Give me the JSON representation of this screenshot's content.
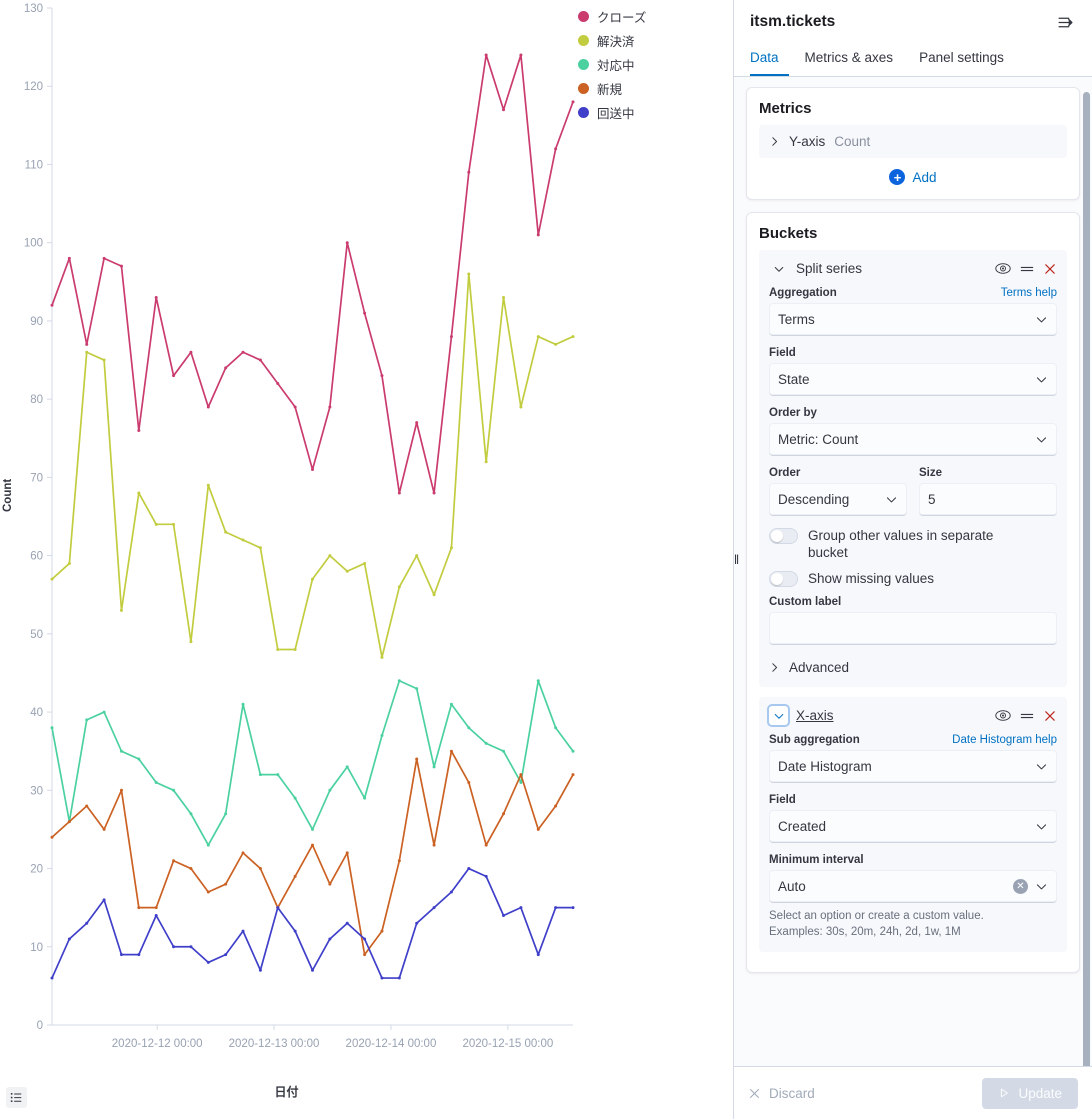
{
  "panel": {
    "title": "itsm.tickets",
    "collapse_icon": "collapse-right-icon",
    "tabs": [
      {
        "label": "Data",
        "active": true
      },
      {
        "label": "Metrics & axes",
        "active": false
      },
      {
        "label": "Panel settings",
        "active": false
      }
    ],
    "metrics": {
      "title": "Metrics",
      "rows": [
        {
          "label": "Y-axis",
          "value": "Count"
        }
      ],
      "add_label": "Add"
    },
    "buckets": {
      "title": "Buckets",
      "split_series": {
        "name": "Split series",
        "aggregation_label": "Aggregation",
        "aggregation_help": "Terms help",
        "aggregation_value": "Terms",
        "field_label": "Field",
        "field_value": "State",
        "order_by_label": "Order by",
        "order_by_value": "Metric: Count",
        "order_label": "Order",
        "order_value": "Descending",
        "size_label": "Size",
        "size_value": "5",
        "group_other_label": "Group other values in separate bucket",
        "group_other_on": false,
        "show_missing_label": "Show missing values",
        "show_missing_on": false,
        "custom_label_label": "Custom label",
        "custom_label_value": "",
        "advanced_label": "Advanced"
      },
      "x_axis": {
        "name": "X-axis",
        "sub_agg_label": "Sub aggregation",
        "sub_agg_help": "Date Histogram help",
        "sub_agg_value": "Date Histogram",
        "field_label": "Field",
        "field_value": "Created",
        "min_interval_label": "Minimum interval",
        "min_interval_value": "Auto",
        "hint_line1": "Select an option or create a custom value.",
        "hint_line2": "Examples: 30s, 20m, 24h, 2d, 1w, 1M"
      }
    },
    "footer": {
      "discard_label": "Discard",
      "update_label": "Update"
    }
  },
  "toolbar": {
    "inspect_icon": "list-inspect-icon"
  },
  "chart_data": {
    "type": "line",
    "title": "",
    "xlabel": "日付",
    "ylabel": "Count",
    "ylim": [
      0,
      130
    ],
    "yticks": [
      0,
      10,
      20,
      30,
      40,
      50,
      60,
      70,
      80,
      90,
      100,
      110,
      120,
      130
    ],
    "grid": false,
    "legend_position": "top-right",
    "xtick_labels": [
      "2020-12-12 00:00",
      "2020-12-13 00:00",
      "2020-12-14 00:00",
      "2020-12-15 00:00"
    ],
    "xtick_positions": [
      0.2019,
      0.4262,
      0.6506,
      0.875
    ],
    "colors": {
      "クローズ": "#ca3b6e",
      "解決済": "#c2cc3f",
      "対応中": "#4bd1a0",
      "新規": "#cb6122",
      "回送中": "#3f3fc9"
    },
    "series": [
      {
        "name": "クローズ",
        "color": "#ca3b6e",
        "values": [
          92,
          98,
          87,
          98,
          97,
          76,
          93,
          83,
          86,
          79,
          84,
          86,
          85,
          82,
          79,
          71,
          79,
          100,
          91,
          83,
          68,
          77,
          68,
          88,
          109,
          124,
          117,
          124,
          101,
          112,
          118
        ]
      },
      {
        "name": "解決済",
        "color": "#c2cc3f",
        "values": [
          57,
          59,
          86,
          85,
          53,
          68,
          64,
          64,
          49,
          69,
          63,
          62,
          61,
          48,
          48,
          57,
          60,
          58,
          59,
          47,
          56,
          60,
          55,
          61,
          96,
          72,
          93,
          79,
          88,
          87,
          88
        ]
      },
      {
        "name": "対応中",
        "color": "#4bd1a0",
        "values": [
          38,
          26,
          39,
          40,
          35,
          34,
          31,
          30,
          27,
          23,
          27,
          41,
          32,
          32,
          29,
          25,
          30,
          33,
          29,
          37,
          44,
          43,
          33,
          41,
          38,
          36,
          35,
          31,
          44,
          38,
          35
        ]
      },
      {
        "name": "新規",
        "color": "#cb6122",
        "values": [
          24,
          26,
          28,
          25,
          30,
          15,
          15,
          21,
          20,
          17,
          18,
          22,
          20,
          15,
          19,
          23,
          18,
          22,
          9,
          12,
          21,
          34,
          23,
          35,
          31,
          23,
          27,
          32,
          25,
          28,
          32
        ]
      },
      {
        "name": "回送中",
        "color": "#3f3fc9",
        "values": [
          6,
          11,
          13,
          16,
          9,
          9,
          14,
          10,
          10,
          8,
          9,
          12,
          7,
          15,
          12,
          7,
          11,
          13,
          11,
          6,
          6,
          13,
          15,
          17,
          20,
          19,
          14,
          15,
          9,
          15,
          15
        ]
      }
    ]
  }
}
